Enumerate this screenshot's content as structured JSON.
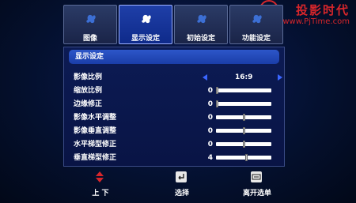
{
  "watermark": {
    "brand": "投影时代",
    "url": "www.PjTime.com"
  },
  "tabs": [
    {
      "label": "图像",
      "icon": "image-icon",
      "active": false
    },
    {
      "label": "显示设定",
      "icon": "display-icon",
      "active": true
    },
    {
      "label": "初始设定",
      "icon": "setup-icon",
      "active": false
    },
    {
      "label": "功能设定",
      "icon": "function-icon",
      "active": false
    }
  ],
  "panel": {
    "title": "显示设定",
    "rows": [
      {
        "label": "影像比例",
        "type": "select",
        "value": "16:9"
      },
      {
        "label": "缩放比例",
        "type": "slider",
        "value": "0",
        "level": 0.0
      },
      {
        "label": "边缘修正",
        "type": "slider",
        "value": "0",
        "level": 0.0
      },
      {
        "label": "影像水平调整",
        "type": "slider",
        "value": "0",
        "level": 0.5
      },
      {
        "label": "影像垂直调整",
        "type": "slider",
        "value": "0",
        "level": 0.5
      },
      {
        "label": "水平梯型修正",
        "type": "slider",
        "value": "0",
        "level": 0.5
      },
      {
        "label": "垂直梯型修正",
        "type": "slider",
        "value": "4",
        "level": 0.55
      }
    ]
  },
  "help": [
    {
      "label": "上 下",
      "icon": "up-down-icon"
    },
    {
      "label": "选择",
      "icon": "enter-icon"
    },
    {
      "label": "离开选单",
      "icon": "menu-icon"
    }
  ],
  "colors": {
    "accent": "#1f3fa8",
    "arrow": "#3a66ff",
    "updown": "#d7262b"
  }
}
